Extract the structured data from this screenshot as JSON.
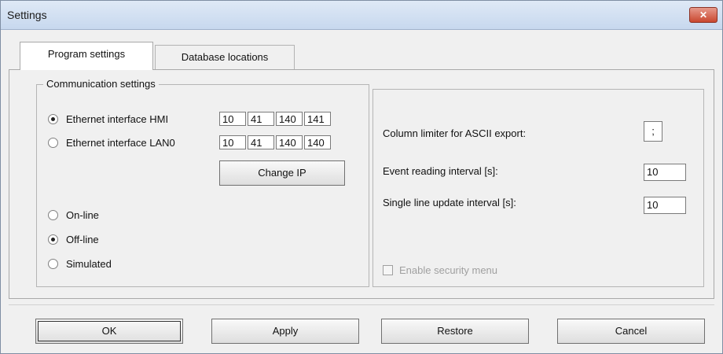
{
  "window": {
    "title": "Settings",
    "close_glyph": "✕"
  },
  "tabs": [
    {
      "label": "Program settings"
    },
    {
      "label": "Database locations"
    }
  ],
  "communication": {
    "legend": "Communication settings",
    "interfaces": [
      {
        "label": "Ethernet interface HMI",
        "checked": true,
        "ip": [
          "10",
          "41",
          "140",
          "141"
        ]
      },
      {
        "label": "Ethernet interface LAN0",
        "checked": false,
        "ip": [
          "10",
          "41",
          "140",
          "140"
        ]
      }
    ],
    "change_ip_label": "Change IP",
    "modes": [
      {
        "label": "On-line",
        "checked": false
      },
      {
        "label": "Off-line",
        "checked": true
      },
      {
        "label": "Simulated",
        "checked": false
      }
    ]
  },
  "right": {
    "column_limiter_label": "Column limiter for ASCII export:",
    "column_limiter_value": ";",
    "event_interval_label": "Event reading interval [s]:",
    "event_interval_value": "10",
    "single_line_label": "Single line update interval [s]:",
    "single_line_value": "10",
    "security_menu_label": "Enable security menu"
  },
  "buttons": {
    "ok": "OK",
    "apply": "Apply",
    "restore": "Restore",
    "cancel": "Cancel"
  }
}
